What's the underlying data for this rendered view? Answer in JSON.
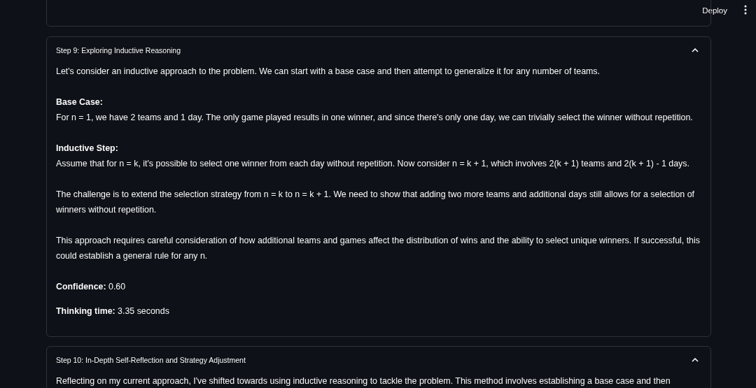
{
  "header": {
    "deploy": "Deploy"
  },
  "steps": [
    {
      "title": "Step 9: Exploring Inductive Reasoning",
      "expanded": true,
      "paragraphs": [
        {
          "text": "Let's consider an inductive approach to the problem. We can start with a base case and then attempt to generalize it for any number of teams."
        },
        {
          "heading": "Base Case:",
          "text": "For n = 1, we have 2 teams and 1 day. The only game played results in one winner, and since there's only one day, we can trivially select the winner without repetition."
        },
        {
          "heading": "Inductive Step:",
          "text": "Assume that for n = k, it's possible to select one winner from each day without repetition. Now consider n = k + 1, which involves 2(k + 1) teams and 2(k + 1) - 1 days."
        },
        {
          "text": "The challenge is to extend the selection strategy from n = k to n = k + 1. We need to show that adding two more teams and additional days still allows for a selection of winners without repetition."
        },
        {
          "text": "This approach requires careful consideration of how additional teams and games affect the distribution of wins and the ability to select unique winners. If successful, this could establish a general rule for any n."
        }
      ],
      "confidence": "**Confidence:** 0.60",
      "thinking_time": "**Thinking time:** 3.35 seconds"
    },
    {
      "title": "Step 10: In-Depth Self-Reflection and Strategy Adjustment",
      "expanded": true,
      "paragraphs": [
        {
          "text": "Reflecting on my current approach, I've shifted towards using inductive reasoning to tackle the problem. This method involves establishing a base case and then"
        }
      ]
    }
  ]
}
